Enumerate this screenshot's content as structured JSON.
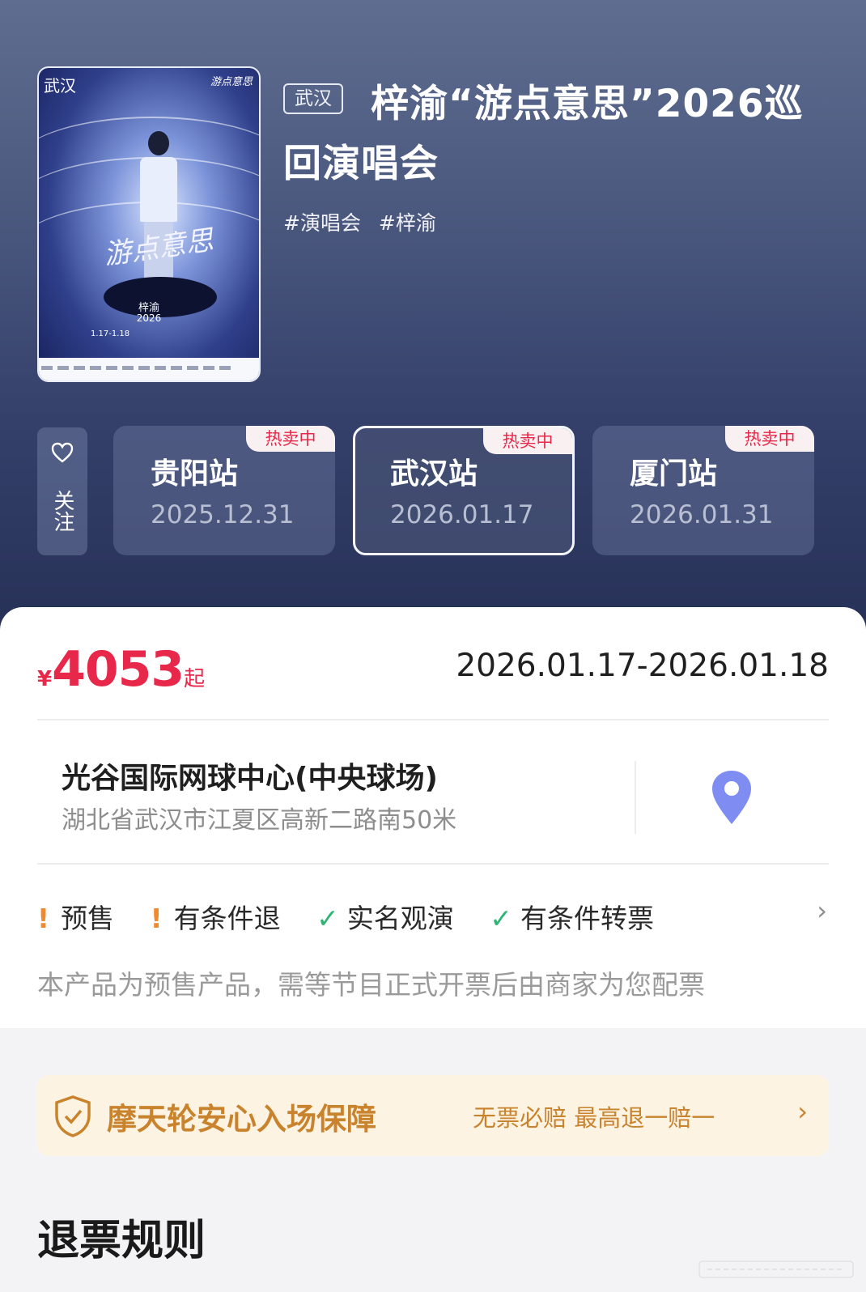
{
  "poster": {
    "city": "武汉",
    "brand": "游点意思",
    "calligraphy": "游点意思",
    "artist": "梓渝",
    "year": "2026",
    "date": "1.17-1.18"
  },
  "event": {
    "city_tag": "武汉",
    "title": "梓渝“游点意思”2026巡回演唱会",
    "tags": [
      "#演唱会",
      "#梓渝"
    ]
  },
  "follow": {
    "label": "关注"
  },
  "stations": [
    {
      "name": "贵阳站",
      "date": "2025.12.31",
      "badge": "热卖中",
      "selected": false
    },
    {
      "name": "武汉站",
      "date": "2026.01.17",
      "badge": "热卖中",
      "selected": true
    },
    {
      "name": "厦门站",
      "date": "2026.01.31",
      "badge": "热卖中",
      "selected": false
    }
  ],
  "price": {
    "currency": "¥",
    "amount": "4053",
    "suffix": "起"
  },
  "date_range": "2026.01.17-2026.01.18",
  "venue": {
    "name": "光谷国际网球中心(中央球场)",
    "address": "湖北省武汉市江夏区高新二路南50米"
  },
  "policies": [
    {
      "type": "warn",
      "label": "预售"
    },
    {
      "type": "warn",
      "label": "有条件退"
    },
    {
      "type": "ok",
      "label": "实名观演"
    },
    {
      "type": "ok",
      "label": "有条件转票"
    }
  ],
  "notice": "本产品为预售产品，需等节目正式开票后由商家为您配票",
  "guarantee": {
    "title": "摩天轮安心入场保障",
    "subtitle": "无票必赔  最高退一赔一"
  },
  "refund_section": {
    "title": "退票规则"
  },
  "colors": {
    "price_red": "#e8284a",
    "guarantee_gold": "#c9832d",
    "pin_blue": "#7f8cf2",
    "ok_green": "#2bb673",
    "warn_orange": "#f18a2f"
  }
}
